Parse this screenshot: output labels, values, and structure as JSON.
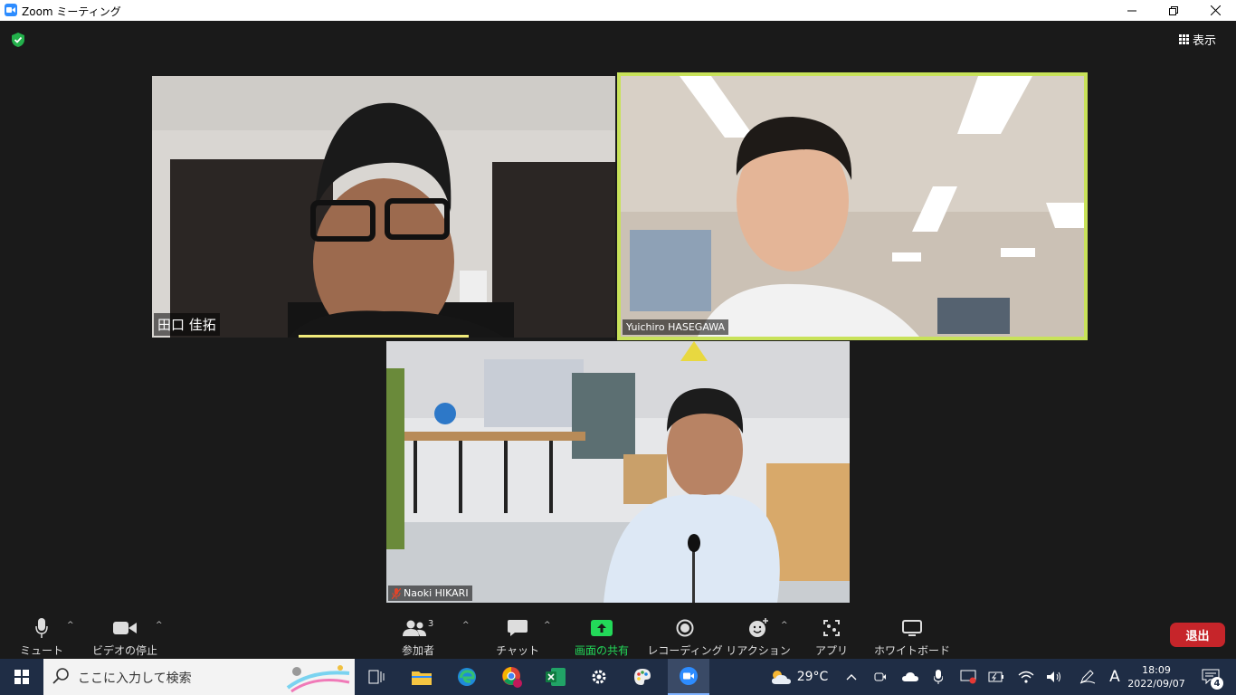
{
  "window": {
    "title": "Zoom ミーティング"
  },
  "header": {
    "view_label": "表示"
  },
  "participants": [
    {
      "name": "田口 佳拓",
      "active_speaker": false,
      "muted": false
    },
    {
      "name": "Yuichiro HASEGAWA",
      "active_speaker": true,
      "muted": false
    },
    {
      "name": "Naoki HIKARI",
      "active_speaker": false,
      "muted": true
    }
  ],
  "toolbar": {
    "mute_label": "ミュート",
    "video_label": "ビデオの停止",
    "participants_label": "参加者",
    "participants_count": "3",
    "chat_label": "チャット",
    "share_label": "画面の共有",
    "record_label": "レコーディング",
    "reactions_label": "リアクション",
    "apps_label": "アプリ",
    "whiteboard_label": "ホワイトボード",
    "leave_label": "退出"
  },
  "taskbar": {
    "search_placeholder": "ここに入力して検索",
    "weather_temp": "29°C",
    "ime": "A",
    "time": "18:09",
    "date": "2022/09/07",
    "notification_count": "4"
  },
  "colors": {
    "accent": "#2d8cff",
    "active_border": "#c8e25a",
    "share_green": "#23d959",
    "leave_red": "#c6252a",
    "taskbar": "#1f2d45"
  }
}
